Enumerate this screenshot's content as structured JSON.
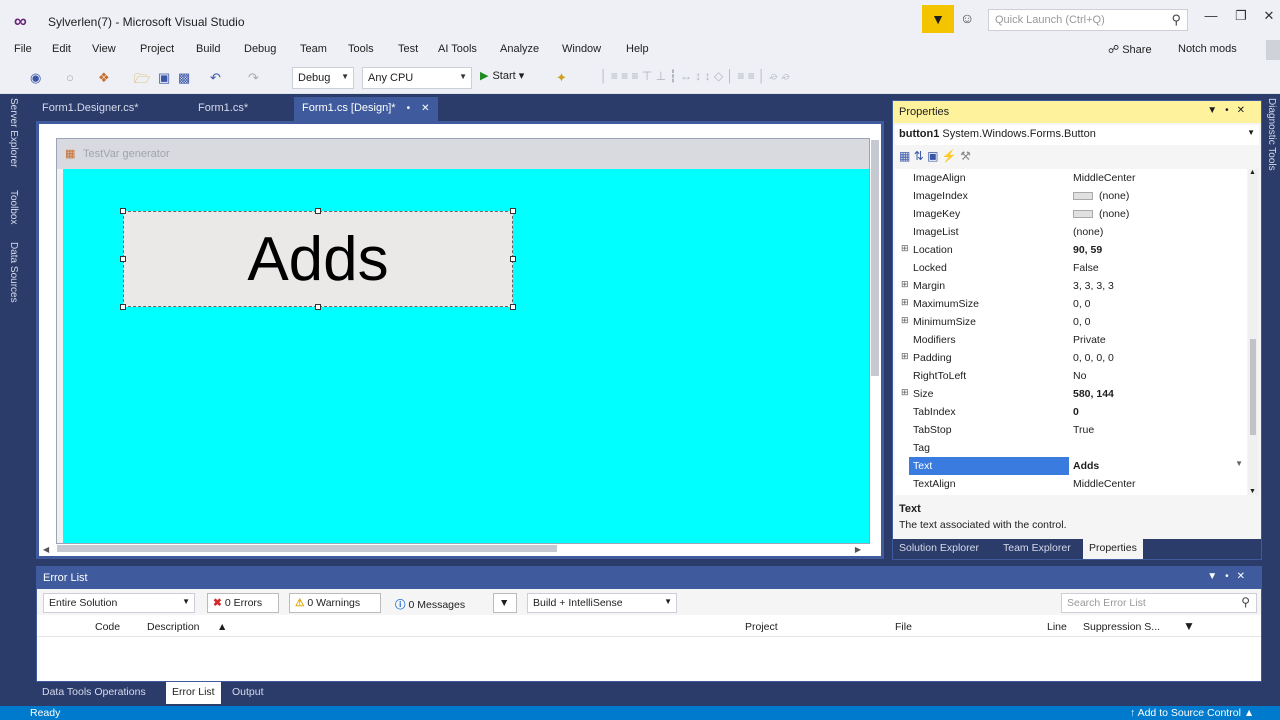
{
  "window": {
    "title": "Sylverlen(7) - Microsoft Visual Studio",
    "quick_launch_placeholder": "Quick Launch (Ctrl+Q)"
  },
  "menu": {
    "items": [
      "File",
      "Edit",
      "View",
      "Project",
      "Build",
      "Debug",
      "Team",
      "Tools",
      "Test",
      "AI Tools",
      "Analyze",
      "Window",
      "Help"
    ],
    "share_label": "Share",
    "user_name": "Notch mods"
  },
  "toolbar": {
    "configuration": "Debug",
    "platform": "Any CPU",
    "start_label": "Start"
  },
  "left_tool_tabs": [
    "Server Explorer",
    "Toolbox",
    "Data Sources"
  ],
  "right_tool_tabs": [
    "Diagnostic Tools"
  ],
  "doc_tabs": [
    {
      "label": "Form1.Designer.cs*",
      "active": false
    },
    {
      "label": "Form1.cs*",
      "active": false
    },
    {
      "label": "Form1.cs [Design]*",
      "active": true
    }
  ],
  "designer": {
    "form_title": "TestVar generator",
    "button_text": "Adds",
    "form_back_color": "#00ffff"
  },
  "properties": {
    "header": "Properties",
    "object_name": "button1",
    "object_type": "System.Windows.Forms.Button",
    "rows": [
      {
        "name": "ImageAlign",
        "value": "MiddleCenter",
        "bold": false,
        "expand": false,
        "swatch": false
      },
      {
        "name": "ImageIndex",
        "value": "(none)",
        "bold": false,
        "expand": false,
        "swatch": true
      },
      {
        "name": "ImageKey",
        "value": "(none)",
        "bold": false,
        "expand": false,
        "swatch": true
      },
      {
        "name": "ImageList",
        "value": "(none)",
        "bold": false,
        "expand": false,
        "swatch": false
      },
      {
        "name": "Location",
        "value": "90, 59",
        "bold": true,
        "expand": true,
        "swatch": false
      },
      {
        "name": "Locked",
        "value": "False",
        "bold": false,
        "expand": false,
        "swatch": false
      },
      {
        "name": "Margin",
        "value": "3, 3, 3, 3",
        "bold": false,
        "expand": true,
        "swatch": false
      },
      {
        "name": "MaximumSize",
        "value": "0, 0",
        "bold": false,
        "expand": true,
        "swatch": false
      },
      {
        "name": "MinimumSize",
        "value": "0, 0",
        "bold": false,
        "expand": true,
        "swatch": false
      },
      {
        "name": "Modifiers",
        "value": "Private",
        "bold": false,
        "expand": false,
        "swatch": false
      },
      {
        "name": "Padding",
        "value": "0, 0, 0, 0",
        "bold": false,
        "expand": true,
        "swatch": false
      },
      {
        "name": "RightToLeft",
        "value": "No",
        "bold": false,
        "expand": false,
        "swatch": false
      },
      {
        "name": "Size",
        "value": "580, 144",
        "bold": true,
        "expand": true,
        "swatch": false
      },
      {
        "name": "TabIndex",
        "value": "0",
        "bold": true,
        "expand": false,
        "swatch": false
      },
      {
        "name": "TabStop",
        "value": "True",
        "bold": false,
        "expand": false,
        "swatch": false
      },
      {
        "name": "Tag",
        "value": "",
        "bold": false,
        "expand": false,
        "swatch": false
      },
      {
        "name": "Text",
        "value": "Adds",
        "bold": true,
        "expand": false,
        "swatch": false,
        "selected": true
      },
      {
        "name": "TextAlign",
        "value": "MiddleCenter",
        "bold": false,
        "expand": false,
        "swatch": false
      }
    ],
    "desc_title": "Text",
    "desc_text": "The text associated with the control.",
    "panel_tabs": [
      "Solution Explorer",
      "Team Explorer",
      "Properties"
    ]
  },
  "error_list": {
    "header": "Error List",
    "scope": "Entire Solution",
    "errors_label": "0 Errors",
    "warnings_label": "0 Warnings",
    "messages_label": "0 Messages",
    "build_filter": "Build + IntelliSense",
    "search_placeholder": "Search Error List",
    "columns": [
      "Code",
      "Description",
      "Project",
      "File",
      "Line",
      "Suppression S..."
    ]
  },
  "bottom_tabs": [
    "Data Tools Operations",
    "Error List",
    "Output"
  ],
  "status": {
    "left": "Ready",
    "right": "↑ Add to Source Control ▲"
  }
}
